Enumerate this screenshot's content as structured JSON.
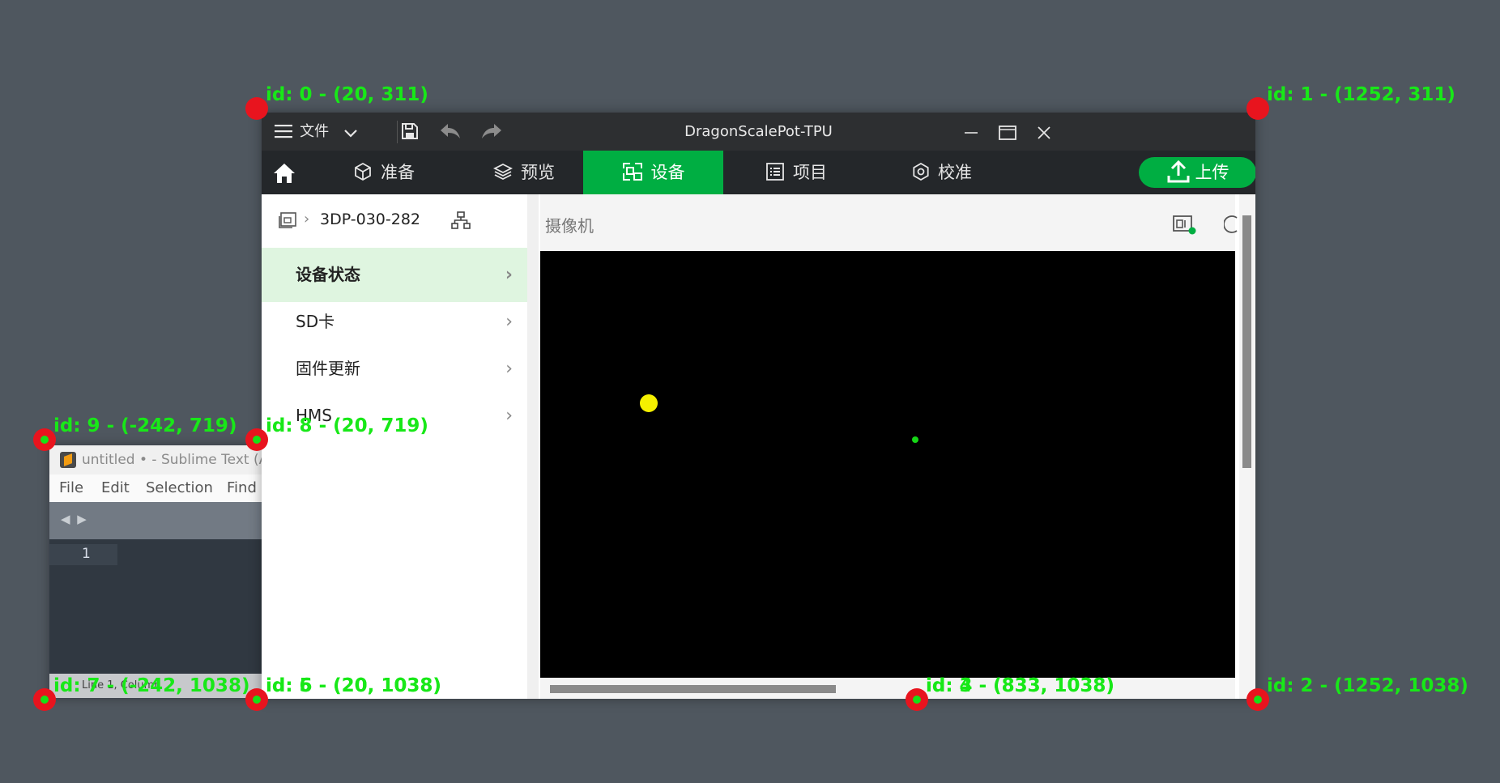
{
  "sublime": {
    "title": "untitled • - Sublime Text (AD",
    "menu": [
      "File",
      "Edit",
      "Selection",
      "Find"
    ],
    "tab_arrows": "◀ ▶",
    "line_number": "1",
    "status": "Line 1, Column"
  },
  "app": {
    "title": "DragonScalePot-TPU",
    "file_menu_label": "文件",
    "icons": {
      "menu": "hamburger-icon",
      "dropdown": "chevron-down-icon",
      "save": "save-icon",
      "undo": "undo-icon",
      "redo": "redo-icon",
      "minimize": "minimize-icon",
      "maximize": "maximize-icon",
      "close": "close-icon",
      "home": "home-icon",
      "upload": "upload-icon"
    },
    "nav": {
      "tabs": [
        {
          "label": "准备",
          "icon": "cube-icon"
        },
        {
          "label": "预览",
          "icon": "layers-icon"
        },
        {
          "label": "设备",
          "icon": "device-icon",
          "active": true
        },
        {
          "label": "项目",
          "icon": "list-icon"
        },
        {
          "label": "校准",
          "icon": "calibrate-icon"
        }
      ],
      "upload_label": "上传"
    },
    "sidebar": {
      "device_name": "3DP-030-282",
      "items": [
        {
          "label": "设备状态",
          "active": true
        },
        {
          "label": "SD卡"
        },
        {
          "label": "固件更新"
        },
        {
          "label": "HMS"
        }
      ]
    },
    "camera": {
      "title": "摄像机"
    },
    "colors": {
      "accent": "#00ae42",
      "titlebar": "#2d2f31",
      "navbar": "#24272a",
      "active_item_bg": "#dff5e0"
    }
  },
  "overlay": {
    "points": [
      {
        "label": "id: 0 - (20, 311)"
      },
      {
        "label": "id: 1 - (1252, 311)"
      },
      {
        "label": "id: 2 - (1252, 1038)"
      },
      {
        "label": "id: 3 - (833, 1038)"
      },
      {
        "label": "id: 4 - (833, 1038)"
      },
      {
        "label": "id: 5 - (20, 1038)"
      },
      {
        "label": "id: 6 - (20, 1038)"
      },
      {
        "label": "id: 7 - (-242, 1038)"
      },
      {
        "label": "id: 8 - (20, 719)"
      },
      {
        "label": "id: 9 - (-242, 719)"
      }
    ]
  }
}
